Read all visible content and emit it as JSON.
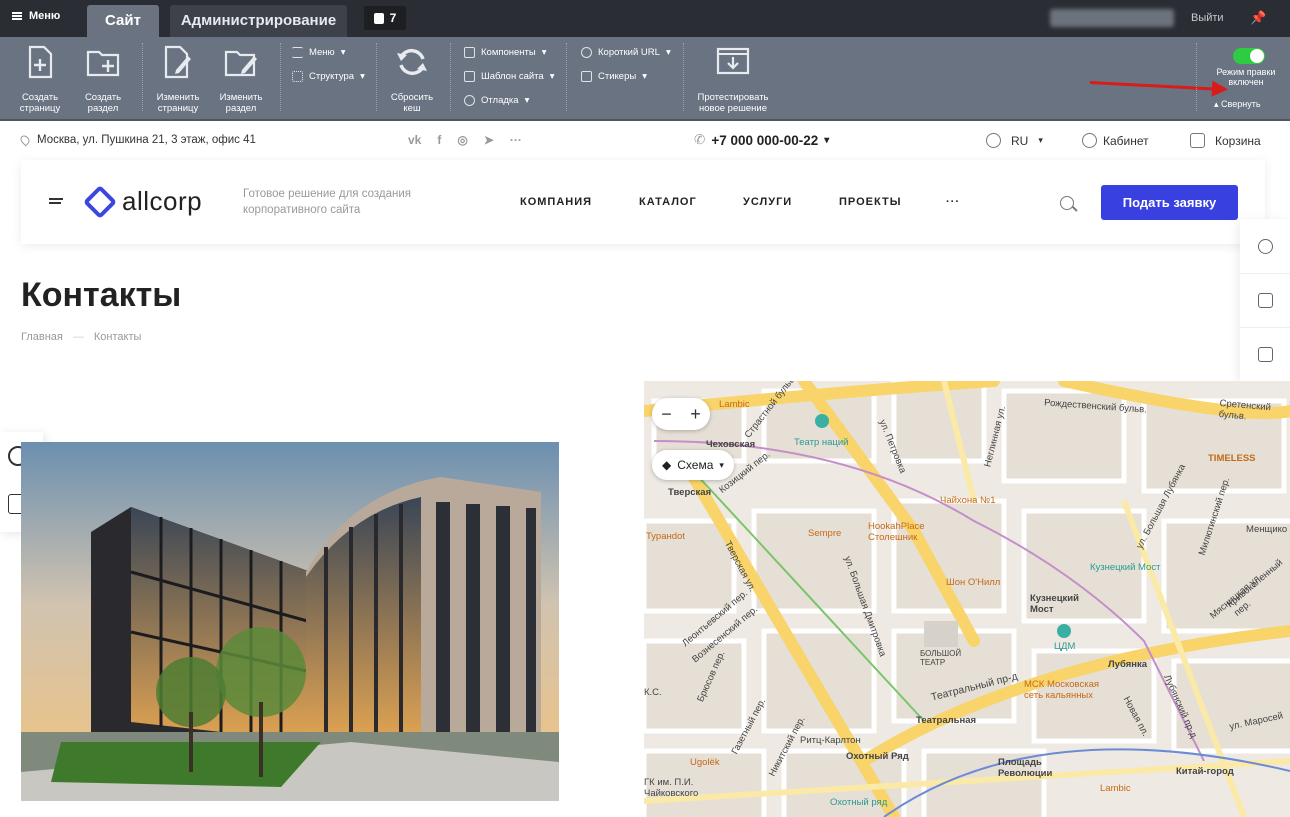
{
  "admin": {
    "menu_label": "Меню",
    "tab_site": "Сайт",
    "tab_admin": "Администрирование",
    "notifications": "7",
    "logout": "Выйти"
  },
  "toolbar": {
    "create_page": "Создать страницу",
    "create_section": "Создать раздел",
    "edit_page": "Изменить страницу",
    "edit_section": "Изменить раздел",
    "menu": "Меню",
    "structure": "Структура",
    "reset_cache": "Сбросить кеш",
    "components": "Компоненты",
    "template": "Шаблон сайта",
    "debug": "Отладка",
    "short_url": "Короткий URL",
    "stickers": "Стикеры",
    "test_solution": "Протестировать новое решение",
    "edit_mode": "Режим правки включен",
    "collapse": "Свернуть"
  },
  "infobar": {
    "address": "Москва, ул. Пушкина 21, 3 этаж, офис 41",
    "socials": [
      "vk",
      "f",
      "◎",
      "➤",
      "···"
    ],
    "phone": "+7 000 000-00-22",
    "lang": "RU",
    "cabinet": "Кабинет",
    "cart": "Корзина"
  },
  "header": {
    "brand": "allcorp",
    "tagline": "Готовое решение для создания корпоративного сайта",
    "nav": [
      "КОМПАНИЯ",
      "КАТАЛОГ",
      "УСЛУГИ",
      "ПРОЕКТЫ",
      "···"
    ],
    "cta": "Подать заявку"
  },
  "page": {
    "title": "Контакты",
    "breadcrumbs": [
      "Главная",
      "—",
      "Контакты"
    ]
  },
  "map": {
    "zoom_out": "−",
    "zoom_in": "+",
    "layer": "Схема",
    "labels": [
      "Lambic",
      "Чеховская",
      "Тверская",
      "Театр наций",
      "Туранdot",
      "Sempre",
      "HookahPlace Столешник",
      "Чайхона №1",
      "Шон О'Нилл",
      "Кузнецкий Мост",
      "ЦДМ",
      "Лубянка",
      "БОЛЬШОЙ ТЕАТР",
      "Театральный пр-д",
      "Театральная",
      "МСК Московская сеть кальянных",
      "TIMELESS",
      "Кузнецкий Мост",
      "Ритц-Карлтон",
      "Охотный Ряд",
      "Площадь Революции",
      "Китай-город",
      "Ugolëk",
      "Lambic",
      "Рождественский бульв.",
      "Сретенский бульв.",
      "Тверская ул.",
      "ул. Петровка",
      "ул. Большая Лубянка",
      "Неглинная ул.",
      "Новая пл.",
      "ул. Маросей",
      "Менщико",
      "Охотный ряд",
      "К.С.",
      "ГК им. П.И. Чайковского",
      "Страстной бульв.",
      "Козицкий пер.",
      "ул. Большая Дмитровка",
      "Брюсов пер.",
      "Газетный пер.",
      "Никитский пер.",
      "Леонтьевский пер.",
      "Вознесенский пер.",
      "Кривоколенный пер.",
      "Лубянский пр-д",
      "Мясницкая ул.",
      "Милютинский пер."
    ]
  }
}
